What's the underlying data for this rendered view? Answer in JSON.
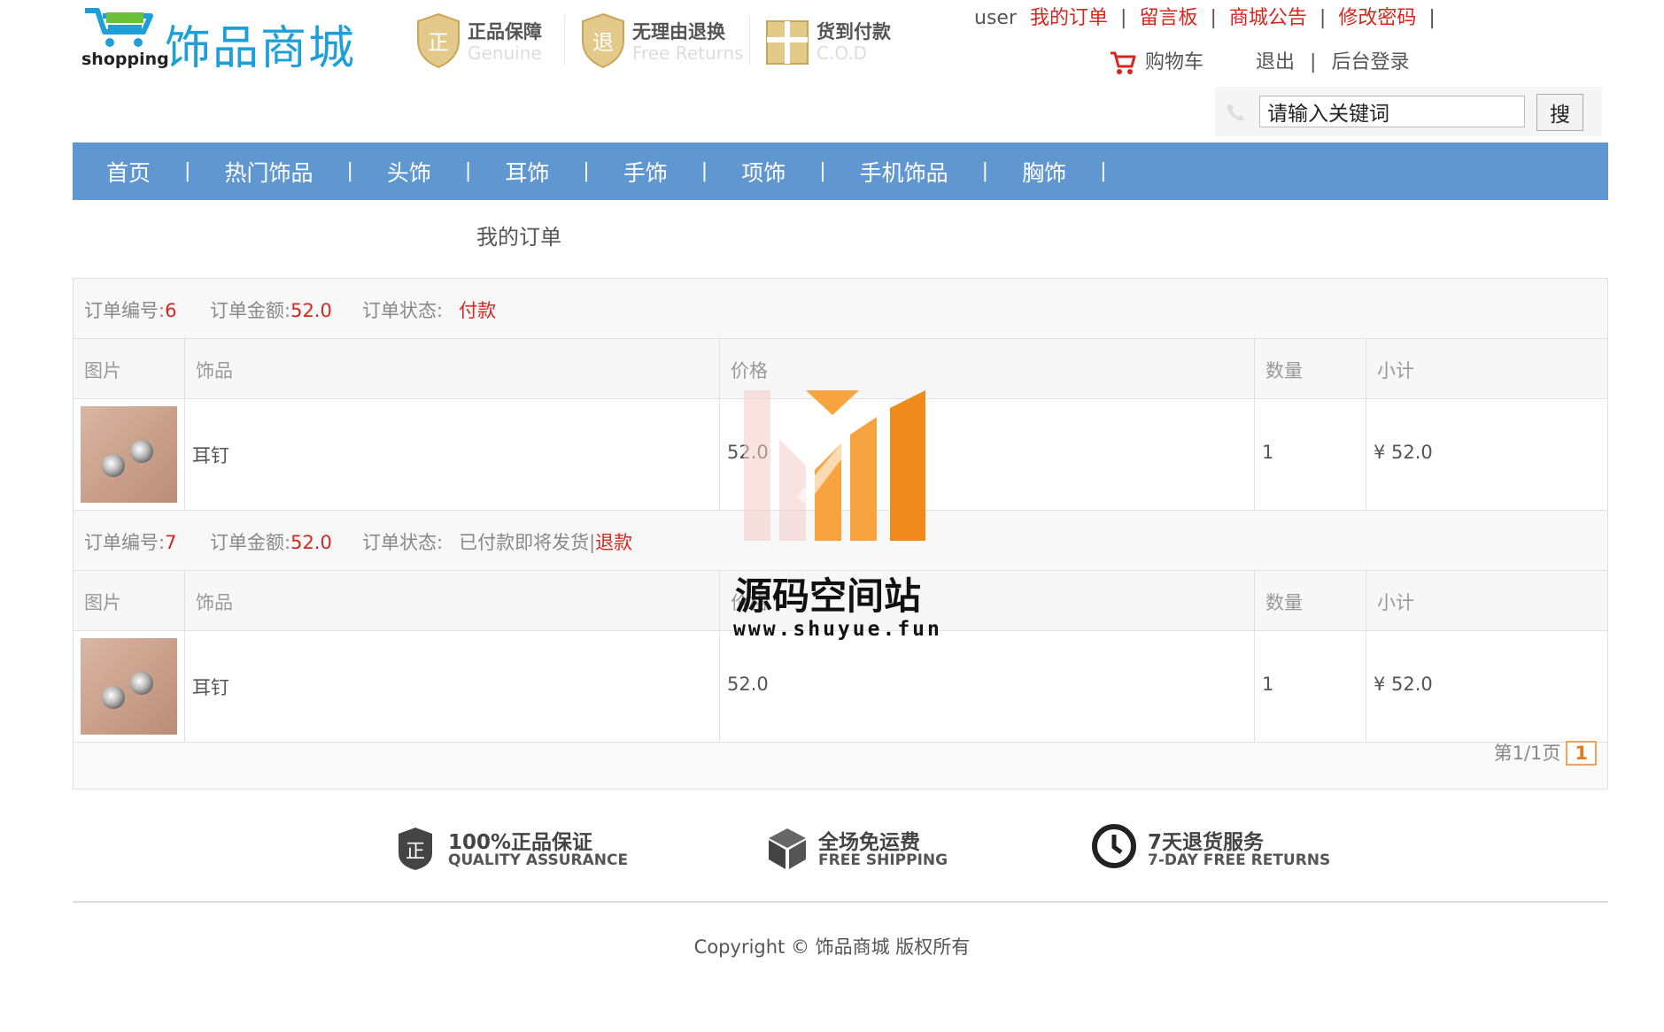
{
  "header": {
    "logo_en": "shopping",
    "logo_cn": "饰品商城",
    "promises": [
      {
        "title": "正品保障",
        "subtitle": "Genuine",
        "icon": "shield-genuine-icon"
      },
      {
        "title": "无理由退换",
        "subtitle": "Free Returns",
        "icon": "shield-returns-icon"
      },
      {
        "title": "货到付款",
        "subtitle": "C.O.D",
        "icon": "gift-cod-icon"
      }
    ],
    "user": "user",
    "links": [
      "我的订单",
      "留言板",
      "商城公告",
      "修改密码"
    ],
    "cart": "购物车",
    "logout": "退出",
    "admin_login": "后台登录",
    "search_placeholder": "请输入关键词",
    "search_button": "搜"
  },
  "nav": [
    "首页",
    "热门饰品",
    "头饰",
    "耳饰",
    "手饰",
    "项饰",
    "手机饰品",
    "胸饰"
  ],
  "page_title": "我的订单",
  "orders": [
    {
      "no_label": "订单编号:",
      "no": "6",
      "amount_label": "订单金额:",
      "amount": "52.0",
      "status_label": "订单状态:",
      "status_action": "付款",
      "columns": [
        "图片",
        "饰品",
        "价格",
        "数量",
        "小计"
      ],
      "item": {
        "name": "耳钉",
        "price": "52.0",
        "qty": "1",
        "subtotal": "¥ 52.0"
      }
    },
    {
      "no_label": "订单编号:",
      "no": "7",
      "amount_label": "订单金额:",
      "amount": "52.0",
      "status_label": "订单状态:",
      "status_text": "已付款即将发货|",
      "status_action": "退款",
      "columns": [
        "图片",
        "饰品",
        "价格",
        "数量",
        "小计"
      ],
      "item": {
        "name": "耳钉",
        "price": "52.0",
        "qty": "1",
        "subtotal": "¥ 52.0"
      }
    }
  ],
  "pager": {
    "text": "第1/1页",
    "current": "1"
  },
  "watermark": {
    "title": "源码空间站",
    "url": "www.shuyue.fun"
  },
  "footer": {
    "features": [
      {
        "title": "100%正品保证",
        "subtitle": "QUALITY ASSURANCE",
        "icon": "genuine-badge-icon"
      },
      {
        "title": "全场免运费",
        "subtitle": "FREE SHIPPING",
        "icon": "box-icon"
      },
      {
        "title": "7天退货服务",
        "subtitle": "7-DAY FREE RETURNS",
        "icon": "clock-icon"
      }
    ],
    "copyright": "Copyright © 饰品商城 版权所有"
  },
  "colors": {
    "nav_bg": "#6197d1",
    "link_red": "#d7261f",
    "brand_blue": "#1e9fd8",
    "pager_orange": "#e07c1c"
  }
}
